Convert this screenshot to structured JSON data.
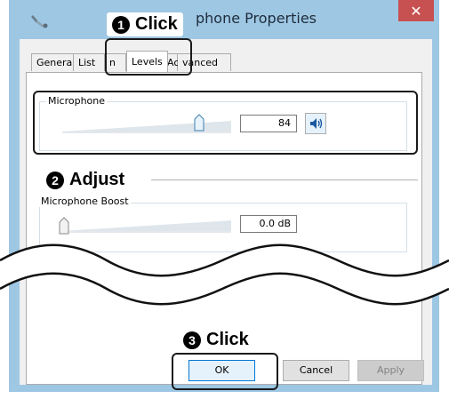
{
  "window": {
    "title": "phone Properties",
    "close_symbol": "✕"
  },
  "tabs": [
    {
      "label": "General"
    },
    {
      "label": "List"
    },
    {
      "label": "n"
    },
    {
      "label": "Levels"
    },
    {
      "label": "Ac"
    },
    {
      "label": "vanced"
    }
  ],
  "levels": {
    "microphone": {
      "label": "Microphone",
      "value": "84",
      "level_percent": 84
    },
    "boost": {
      "label": "Microphone Boost",
      "value": "0.0 dB",
      "level_percent": 0
    }
  },
  "buttons": {
    "ok": "OK",
    "cancel": "Cancel",
    "apply": "Apply"
  },
  "callouts": {
    "step1": {
      "num": "1",
      "text": "Click"
    },
    "step2": {
      "num": "2",
      "text": "Adjust"
    },
    "step3": {
      "num": "3",
      "text": "Click"
    }
  },
  "colors": {
    "title_bar": "#9ec7e4",
    "close_button": "#c75050",
    "slider_fill": "#dfe6eb",
    "callout_outline": "#1a1a1a"
  },
  "icons": {
    "app": "microphone-icon",
    "speaker": "speaker-icon",
    "close": "close-icon"
  }
}
